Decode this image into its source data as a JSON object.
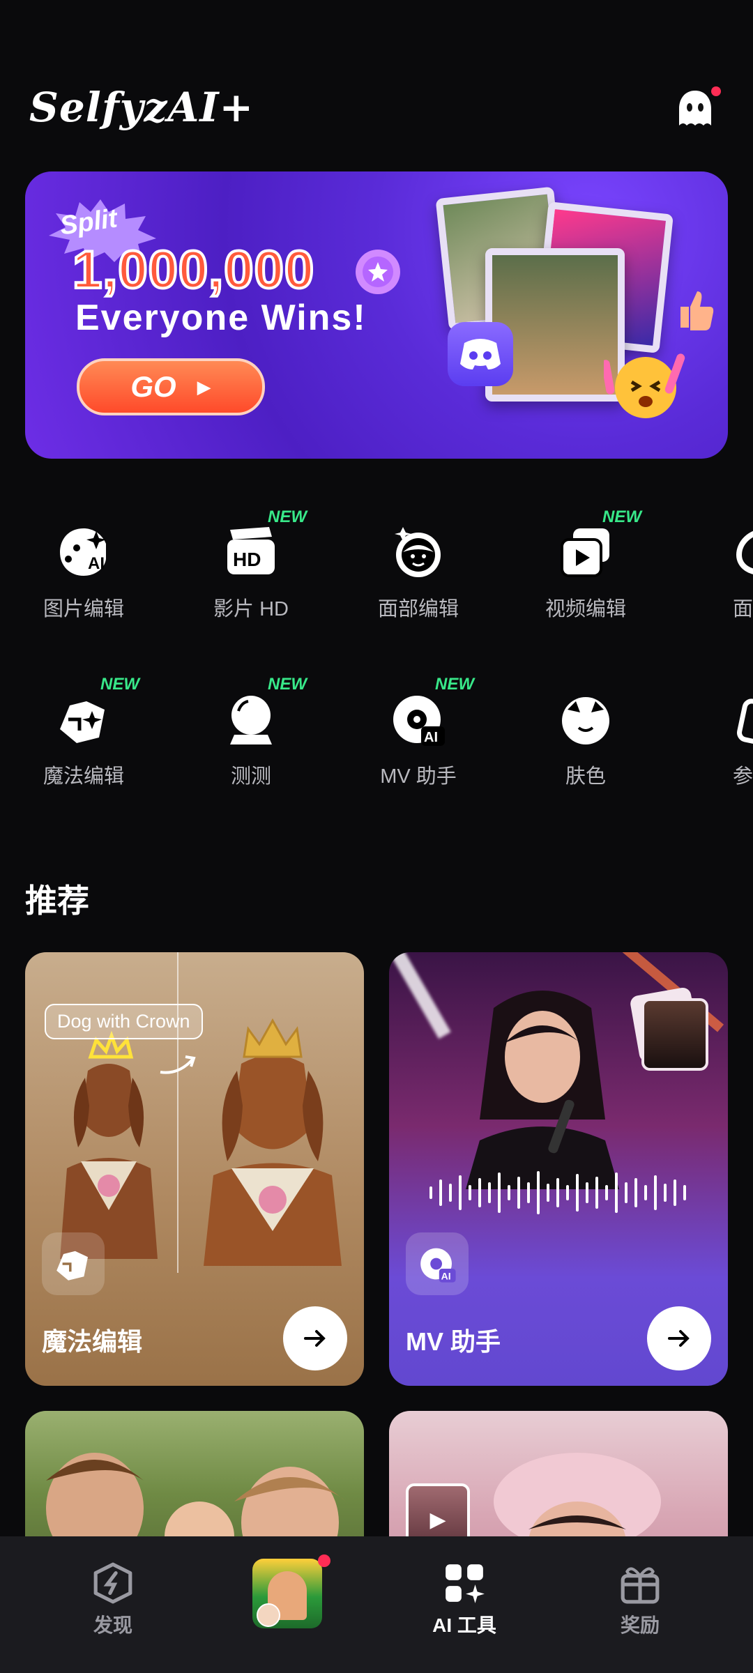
{
  "header": {
    "app_name": "SelfyzAI+",
    "profile_icon": "ghost-icon",
    "notification_dot_color": "#ff2d55"
  },
  "banner": {
    "badge": "Split",
    "amount": "1,000,000",
    "headline": "Everyone Wins!",
    "cta": "GO"
  },
  "tools": {
    "row1": [
      {
        "label": "图片编辑",
        "icon": "ai-face-icon",
        "new": false
      },
      {
        "label": "影片 HD",
        "icon": "hd-film-icon",
        "new": true
      },
      {
        "label": "面部编辑",
        "icon": "face-icon",
        "new": false
      },
      {
        "label": "视频编辑",
        "icon": "video-edit-icon",
        "new": true
      },
      {
        "label": "面部",
        "icon": "face-partial-icon",
        "new": false
      }
    ],
    "row2": [
      {
        "label": "魔法编辑",
        "icon": "magic-edit-icon",
        "new": true
      },
      {
        "label": "测测",
        "icon": "crystal-ball-icon",
        "new": true
      },
      {
        "label": "MV 助手",
        "icon": "mv-assistant-icon",
        "new": true
      },
      {
        "label": "肤色",
        "icon": "skin-tone-icon",
        "new": false
      },
      {
        "label": "参考",
        "icon": "reference-icon",
        "new": false
      }
    ],
    "new_tag": "NEW"
  },
  "recommend": {
    "title": "推荐",
    "cards": [
      {
        "title": "魔法编辑",
        "tag": "Dog with Crown"
      },
      {
        "title": "MV 助手"
      }
    ]
  },
  "bottom_nav": {
    "items": [
      {
        "label": "发现",
        "icon": "discover-icon",
        "active": false
      },
      {
        "label": "",
        "icon": "featured-thumbnail",
        "active": false
      },
      {
        "label": "AI 工具",
        "icon": "ai-tools-icon",
        "active": true
      },
      {
        "label": "奖励",
        "icon": "gift-icon",
        "active": false
      }
    ]
  },
  "colors": {
    "background": "#0a0a0c",
    "new_tag": "#38e889",
    "banner_purple": "#5a2bd8",
    "mv_card_purple": "#6b4bd6",
    "magic_card_brown": "#a17c55"
  }
}
